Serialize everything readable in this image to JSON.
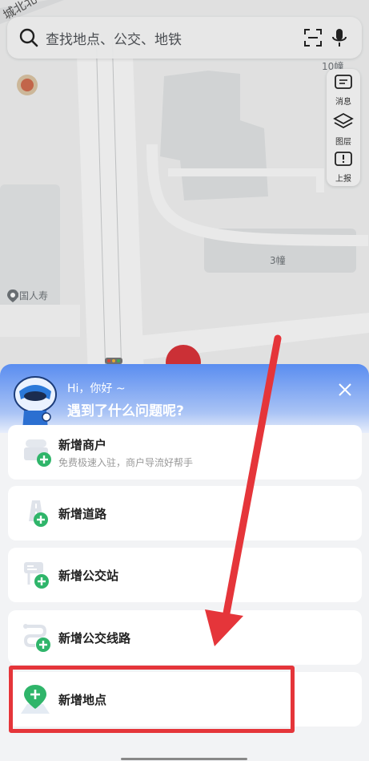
{
  "search": {
    "placeholder": "查找地点、公交、地铁"
  },
  "map": {
    "road_label": "城北北",
    "building_10": "10幢",
    "building_3": "3幢",
    "poi": "中国人寿"
  },
  "tools": [
    {
      "label": "消息",
      "icon": "message-icon"
    },
    {
      "label": "图层",
      "icon": "layers-icon"
    },
    {
      "label": "上报",
      "icon": "report-icon"
    }
  ],
  "panel": {
    "greeting": "Hi，你好 ~",
    "question": "遇到了什么问题呢?",
    "items": [
      {
        "title": "新增商户",
        "subtitle": "免费极速入驻，商户导流好帮手",
        "icon": "store-icon"
      },
      {
        "title": "新增道路",
        "icon": "road-icon"
      },
      {
        "title": "新增公交站",
        "icon": "bus-stop-icon"
      },
      {
        "title": "新增公交线路",
        "icon": "bus-route-icon"
      },
      {
        "title": "新增地点",
        "icon": "place-pin-icon"
      }
    ]
  },
  "colors": {
    "accent_green": "#2fb56a",
    "annotation_red": "#e5353a",
    "header_blue": "#5a8df0"
  }
}
